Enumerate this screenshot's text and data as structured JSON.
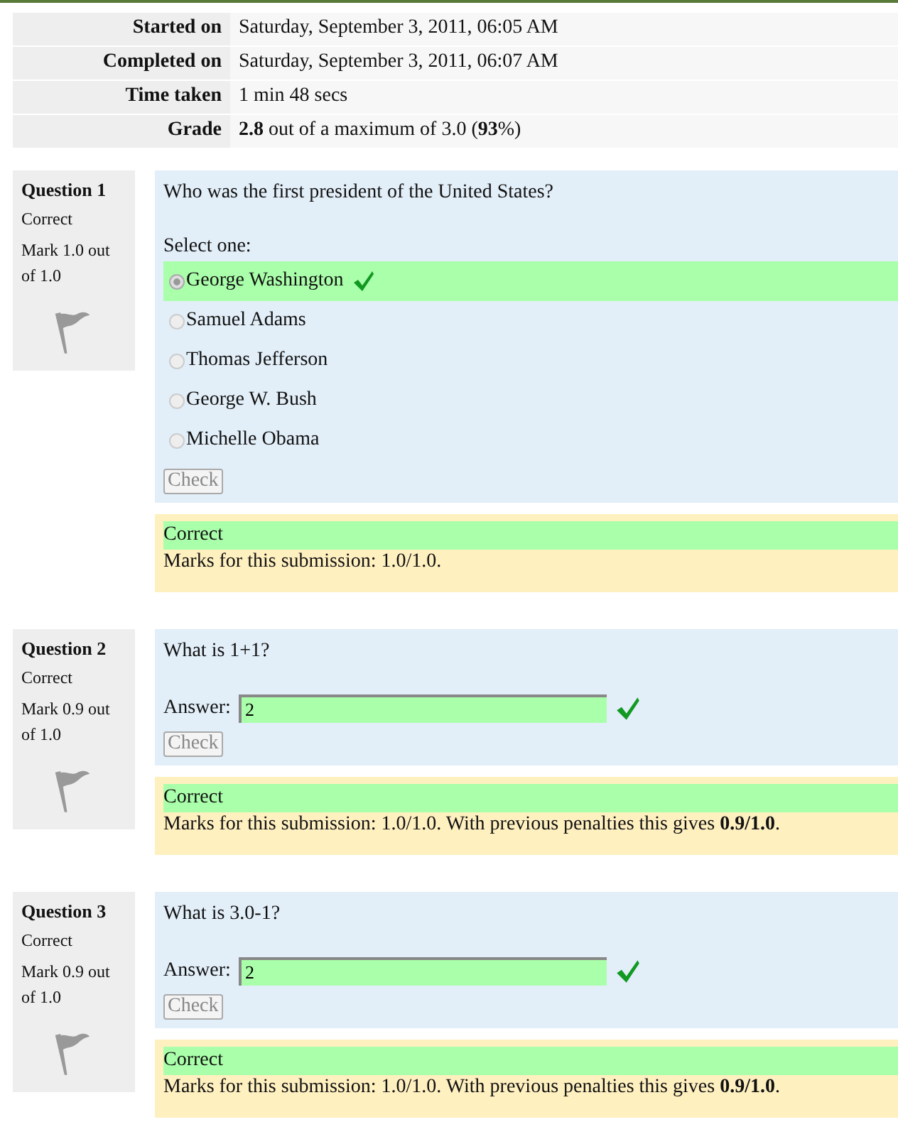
{
  "summary": [
    {
      "label": "Started on",
      "value": "Saturday, September 3, 2011, 06:05 AM"
    },
    {
      "label": "Completed on",
      "value": "Saturday, September 3, 2011, 06:07 AM"
    },
    {
      "label": "Time taken",
      "value": "1 min 48 secs"
    },
    {
      "label": "Grade",
      "value": "**2.8** out of a maximum of 3.0 (**93**%)"
    }
  ],
  "questions": [
    {
      "kind": "multichoice",
      "number": "Question 1",
      "state": "Correct",
      "mark": "Mark 1.0 out of 1.0",
      "text": "Who was the first president of the United States?",
      "prompt": "Select one:",
      "options": [
        {
          "label": "George Washington",
          "selected": true,
          "correct": true
        },
        {
          "label": "Samuel Adams",
          "selected": false,
          "correct": false
        },
        {
          "label": "Thomas Jefferson",
          "selected": false,
          "correct": false
        },
        {
          "label": "George W. Bush",
          "selected": false,
          "correct": false
        },
        {
          "label": "Michelle Obama",
          "selected": false,
          "correct": false
        }
      ],
      "button": "Check",
      "feedback": {
        "correct": true,
        "state": "Correct",
        "marks": "Marks for this submission: 1.0/1.0."
      }
    },
    {
      "kind": "shortanswer",
      "number": "Question 2",
      "state": "Correct",
      "mark": "Mark 0.9 out of 1.0",
      "text": "What is 1+1?",
      "answer_label": "Answer:",
      "answer": "2",
      "correct": true,
      "button": "Check",
      "feedback": {
        "correct": true,
        "state": "Correct",
        "marks": "Marks for this submission: 1.0/1.0. With previous penalties this gives **0.9/1.0**."
      }
    },
    {
      "kind": "shortanswer",
      "number": "Question 3",
      "state": "Correct",
      "mark": "Mark 0.9 out of 1.0",
      "text": "What is 3.0-1?",
      "answer_label": "Answer:",
      "answer": "2",
      "correct": true,
      "button": "Check",
      "feedback": {
        "correct": true,
        "state": "Correct",
        "marks": "Marks for this submission: 1.0/1.0. With previous penalties this gives **0.9/1.0**."
      }
    }
  ]
}
